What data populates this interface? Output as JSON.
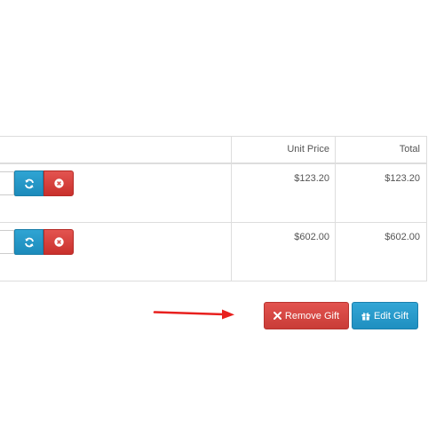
{
  "table": {
    "headers": {
      "unit_price": "Unit Price",
      "total": "Total"
    },
    "rows": [
      {
        "unit_price": "$123.20",
        "total": "$123.20"
      },
      {
        "unit_price": "$602.00",
        "total": "$602.00"
      }
    ]
  },
  "actions": {
    "remove_gift_label": "Remove Gift",
    "edit_gift_label": "Edit Gift"
  },
  "icons": {
    "refresh": "refresh-icon",
    "remove_line": "times-circle-icon",
    "remove_gift": "times-icon",
    "edit_gift": "gift-icon"
  },
  "colors": {
    "danger": "#d9534f",
    "info": "#2a9fd0",
    "annotation_arrow": "#e8201e"
  }
}
